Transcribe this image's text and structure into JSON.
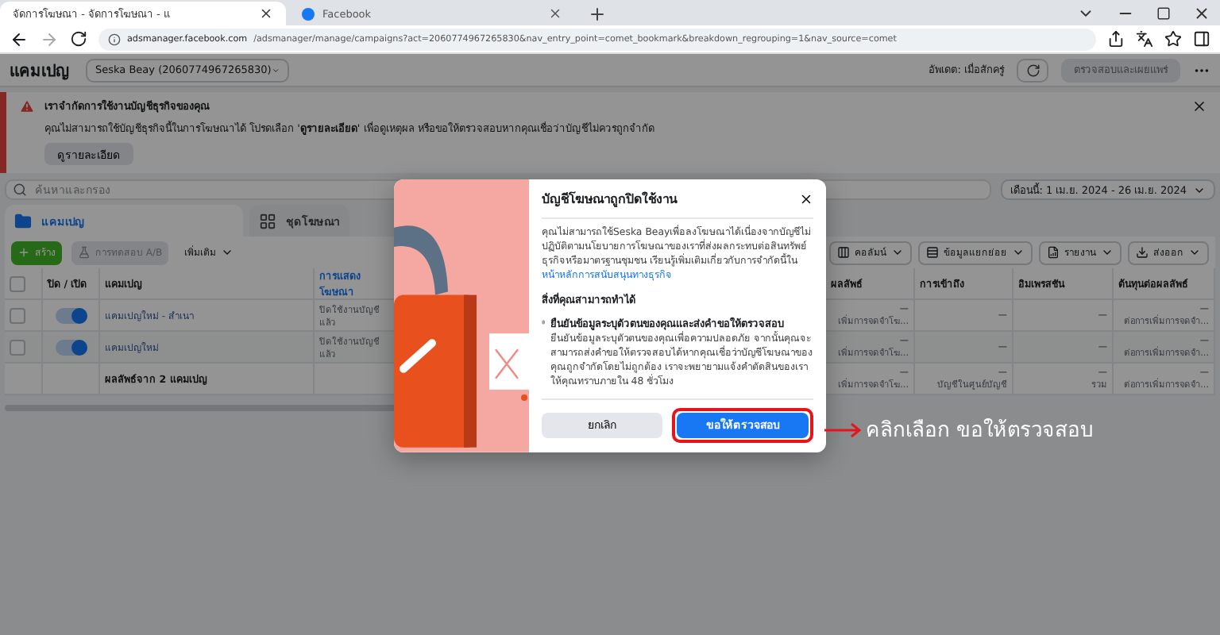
{
  "browser": {
    "tabs": [
      {
        "title": "จัดการโฆษณา - จัดการโฆษณา - แ",
        "selected": true
      },
      {
        "title": "Facebook",
        "selected": false
      }
    ],
    "address_host": "adsmanager.facebook.com",
    "address_path": "/adsmanager/manage/campaigns?act=2060774967265830&nav_entry_point=comet_bookmark&breakdown_regrouping=1&nav_source=comet"
  },
  "header": {
    "title": "แคมเปญ",
    "account": "Seska Beay (2060774967265830)",
    "updated": "อัพเดต: เมื่อสักครู่",
    "publish_button": "ตรวจสอบและเผยแพร่"
  },
  "alert": {
    "title": "เราจำกัดการใช้งานบัญชีธุรกิจของคุณ",
    "message": "คุณไม่สามารถใช้บัญชีธุรกิจนี้ในการโฆษณาได้ โปรดเลือก '**ดูรายละเอียด**' เพื่อดูเหตุผล หรือขอให้ตรวจสอบหากคุณเชื่อว่าบัญชีไม่ควรถูกจำกัด",
    "button": "ดูรายละเอียด"
  },
  "search": {
    "placeholder": "ค้นหาและกรอง"
  },
  "date_range": "เดือนนี้: 1 เม.ย. 2024 - 26 เม.ย. 2024",
  "level_tabs": [
    {
      "label": "แคมเปญ",
      "selected": true
    },
    {
      "label": "ชุดโฆษณา",
      "selected": false
    }
  ],
  "toolbar_left": [
    {
      "label": "สร้าง",
      "kind": "create"
    },
    {
      "label": "การทดสอบ A/B",
      "kind": "test"
    },
    {
      "label": "เพิ่มเติม",
      "kind": "menu"
    }
  ],
  "toolbar_right": [
    {
      "label": "คอลัมน์",
      "kind": "columns"
    },
    {
      "label": "ข้อมูลแยกย่อย",
      "kind": "breakdown"
    },
    {
      "label": "รายงาน",
      "kind": "reports"
    },
    {
      "label": "ส่งออก",
      "kind": "export"
    }
  ],
  "table": {
    "all_checked": false,
    "columns": [
      "",
      "ปิด / เปิด",
      "แคมเปญ",
      "การแสดงโฆษณา",
      "",
      "ผลลัพธ์",
      "การเข้าถึง",
      "อิมเพรสชัน",
      "ต้นทุนต่อผลลัพธ์"
    ],
    "rows": [
      {
        "checked": false,
        "on": true,
        "campaign": "แคมเปญใหม่ - สำเนา",
        "delivery": "ปิดใช้งานบัญชีแล้ว",
        "cells": [
          {
            "main": "—",
            "sub": "เพิ่มการจดจำโฆ..."
          },
          {
            "main": "—"
          },
          {
            "main": "—"
          },
          {
            "main": "—",
            "sub": "ต่อการเพิ่มการจดจำ..."
          }
        ]
      },
      {
        "checked": false,
        "on": true,
        "campaign": "แคมเปญใหม่",
        "delivery": "ปิดใช้งานบัญชีแล้ว",
        "cells": [
          {
            "main": "—",
            "sub": "เพิ่มการจดจำโฆ..."
          },
          {
            "main": "—"
          },
          {
            "main": "—"
          },
          {
            "main": "—",
            "sub": "ต่อการเพิ่มการจดจำ..."
          }
        ]
      }
    ],
    "footer": {
      "label": "ผลลัพธ์จาก 2 แคมเปญ",
      "cells": [
        {
          "main": "—",
          "sub": "เพิ่มการจดจำโฆ..."
        },
        {
          "main": "—",
          "sub": "บัญชีในศูนย์บัญชี"
        },
        {
          "main": "—",
          "sub": "รวม"
        },
        {
          "main": "—",
          "sub": "ต่อการเพิ่มการจดจำ..."
        }
      ]
    }
  },
  "dialog": {
    "title": "บัญชีโฆษณาถูกปิดใช้งาน",
    "body": "คุณไม่สามารถใช้Seska Beayเพื่อลงโฆษณาได้เนื่องจากบัญชีไม่ปฏิบัติตามนโยบายการโฆษณาของเราที่ส่งผลกระทบต่อสินทรัพย์ธุรกิจหรือมาตรฐานชุมชน เรียนรู้เพิ่มเติมเกี่ยวกับการจำกัดนี้ใน",
    "link": "หน้าหลักการสนับสนุนทางธุรกิจ",
    "section": "สิ่งที่คุณสามารถทำได้",
    "option_title": "ยืนยันข้อมูลระบุตัวตนของคุณและส่งคำขอให้ตรวจสอบ",
    "option_text": "ยืนยันข้อมูลระบุตัวตนของคุณเพื่อความปลอดภัย จากนั้นคุณจะสามารถส่งคำขอให้ตรวจสอบได้หากคุณเชื่อว่าบัญชีโฆษณาของคุณถูกจำกัดโดยไม่ถูกต้อง เราจะพยายามแจ้งคำตัดสินของเราให้คุณทราบภายใน 48 ชั่วโมง",
    "cancel": "ยกเลิก",
    "confirm": "ขอให้ตรวจสอบ"
  },
  "annotation": "คลิกเลือก ขอให้ตรวจสอบ"
}
